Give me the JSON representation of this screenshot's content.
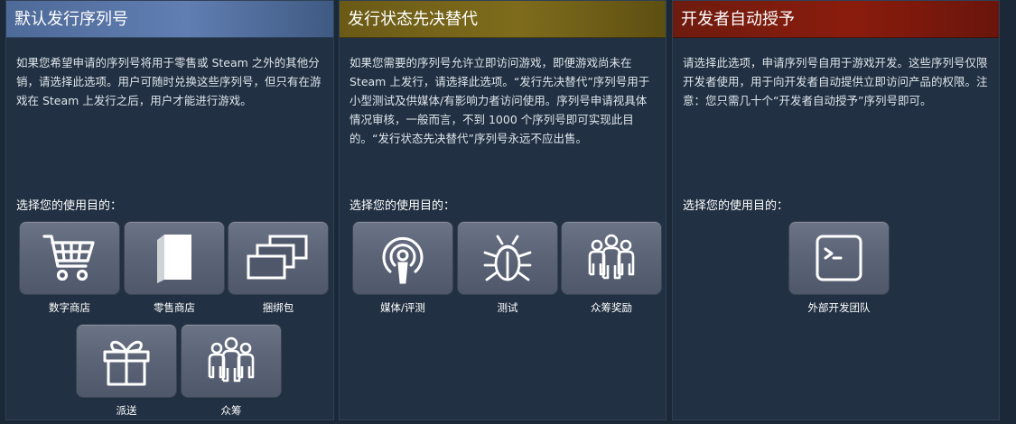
{
  "panels": [
    {
      "title": "默认发行序列号",
      "description": "如果您希望申请的序列号将用于零售或 Steam 之外的其他分销，请选择此选项。用户可随时兑换这些序列号，但只有在游戏在 Steam 上发行之后，用户才能进行游戏。",
      "prompt": "选择您的使用目的：",
      "options": [
        {
          "label": "数字商店",
          "icon": "shopping-cart-icon"
        },
        {
          "label": "零售商店",
          "icon": "retail-box-icon"
        },
        {
          "label": "捆绑包",
          "icon": "bundle-icon"
        },
        {
          "label": "派送",
          "icon": "gift-icon"
        },
        {
          "label": "众筹",
          "icon": "crowd-icon"
        }
      ]
    },
    {
      "title": "发行状态先决替代",
      "description": "如果您需要的序列号允许立即访问游戏，即便游戏尚未在 Steam 上发行，请选择此选项。“发行先决替代”序列号用于小型测试及供媒体/有影响力者访问使用。序列号申请视具体情况审核，一般而言，不到 1000 个序列号即可实现此目的。“发行状态先决替代”序列号永远不应出售。",
      "prompt": "选择您的使用目的：",
      "options": [
        {
          "label": "媒体/评测",
          "icon": "podcast-icon"
        },
        {
          "label": "测试",
          "icon": "bug-icon"
        },
        {
          "label": "众筹奖励",
          "icon": "crowd-icon"
        }
      ]
    },
    {
      "title": "开发者自动授予",
      "description": "请选择此选项，申请序列号自用于游戏开发。这些序列号仅限开发者使用，用于向开发者自动提供立即访问产品的权限。注意：您只需几十个“开发者自动授予”序列号即可。",
      "prompt": "选择您的使用目的：",
      "options": [
        {
          "label": "外部开发团队",
          "icon": "terminal-icon"
        }
      ]
    }
  ],
  "colors": {
    "background": "#1b2838",
    "panel": "#213042",
    "header_default": "#5a77aa",
    "header_status": "#7a6a1a",
    "header_dev": "#84190c"
  }
}
